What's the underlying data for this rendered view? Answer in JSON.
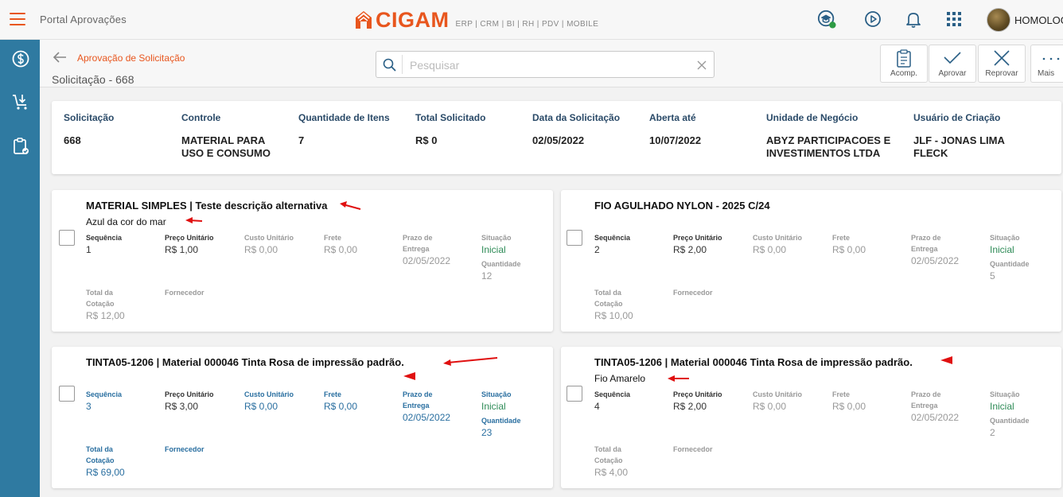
{
  "app": {
    "title": "Portal Aprovações",
    "logo_text": "CIGAM",
    "logo_tagline": "ERP | CRM | BI | RH | PDV | MOBILE",
    "user_name": "HOMOLOG"
  },
  "header": {
    "breadcrumb": "Aprovação de Solicitação",
    "page_title": "Solicitação - 668",
    "search_placeholder": "Pesquisar",
    "actions": {
      "acomp": "Acomp.",
      "aprovar": "Aprovar",
      "reprovar": "Reprovar",
      "mais": "Mais"
    }
  },
  "summary": {
    "solicitacao": {
      "label": "Solicitação",
      "value": "668"
    },
    "controle": {
      "label": "Controle",
      "value": "MATERIAL PARA USO E CONSUMO"
    },
    "quantidade_itens": {
      "label": "Quantidade de Itens",
      "value": "7"
    },
    "total_solicitado": {
      "label": "Total Solicitado",
      "value": "R$ 0"
    },
    "data_solicitacao": {
      "label": "Data da Solicitação",
      "value": "02/05/2022"
    },
    "aberta_ate": {
      "label": "Aberta até",
      "value": "10/07/2022"
    },
    "unidade_negocio": {
      "label": "Unidade de Negócio",
      "value": "ABYZ PARTICIPACOES E INVESTIMENTOS LTDA"
    },
    "usuario_criacao": {
      "label": "Usuário de Criação",
      "value": "JLF - JONAS LIMA FLECK"
    }
  },
  "labels": {
    "sequencia": "Sequência",
    "preco_unitario": "Preço Unitário",
    "custo_unitario": "Custo Unitário",
    "frete": "Frete",
    "prazo_entrega": "Prazo de Entrega",
    "situacao": "Situação",
    "quantidade": "Quantidade",
    "total_cotacao": "Total da Cotação",
    "fornecedor": "Fornecedor"
  },
  "items": [
    {
      "title": "MATERIAL SIMPLES | Teste descrição alternativa",
      "subtitle": "Azul da cor do mar",
      "sequencia": "1",
      "preco_unitario": "R$ 1,00",
      "custo_unitario": "R$ 0,00",
      "frete": "R$ 0,00",
      "prazo_entrega": "02/05/2022",
      "situacao": "Inicial",
      "quantidade": "12",
      "total_cotacao": "R$ 12,00",
      "fornecedor": ""
    },
    {
      "title": "FIO AGULHADO NYLON - 2025 C/24",
      "subtitle": "",
      "sequencia": "2",
      "preco_unitario": "R$ 2,00",
      "custo_unitario": "R$ 0,00",
      "frete": "R$ 0,00",
      "prazo_entrega": "02/05/2022",
      "situacao": "Inicial",
      "quantidade": "5",
      "total_cotacao": "R$ 10,00",
      "fornecedor": ""
    },
    {
      "title": "TINTA05-1206 | Material 000046 Tinta Rosa de impressão padrão.",
      "subtitle": "",
      "sequencia": "3",
      "preco_unitario": "R$ 3,00",
      "custo_unitario": "R$ 0,00",
      "frete": "R$ 0,00",
      "prazo_entrega": "02/05/2022",
      "situacao": "Inicial",
      "quantidade": "23",
      "total_cotacao": "R$ 69,00",
      "fornecedor": ""
    },
    {
      "title": "TINTA05-1206 | Material 000046 Tinta Rosa de impressão padrão.",
      "subtitle": "Fio Amarelo",
      "sequencia": "4",
      "preco_unitario": "R$ 2,00",
      "custo_unitario": "R$ 0,00",
      "frete": "R$ 0,00",
      "prazo_entrega": "02/05/2022",
      "situacao": "Inicial",
      "quantidade": "2",
      "total_cotacao": "R$ 4,00",
      "fornecedor": ""
    }
  ],
  "colors": {
    "brand_orange": "#e8561e",
    "sidebar_blue": "#2f7aa1",
    "status_green": "#2e8b57",
    "annotation_red": "#e01010"
  }
}
